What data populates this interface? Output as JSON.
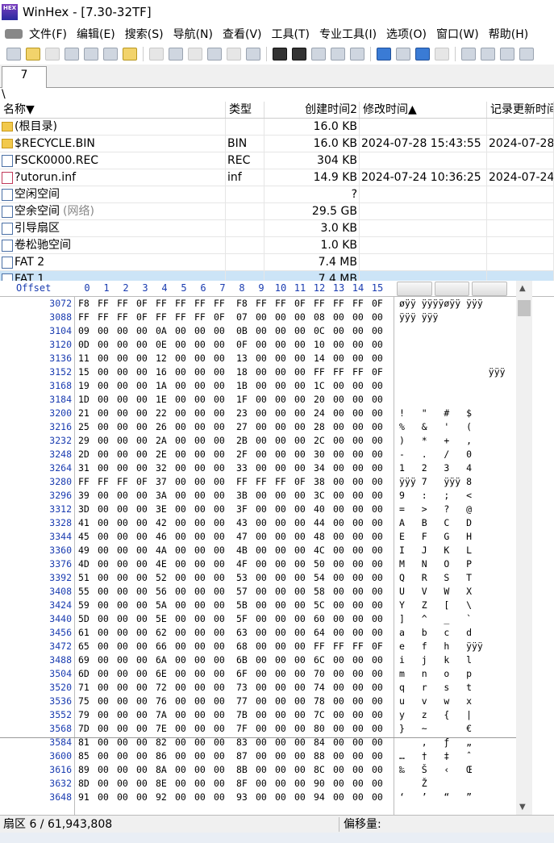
{
  "window": {
    "app_icon_text": "HEX",
    "title": "WinHex - [7.30-32TF]"
  },
  "menu": [
    "文件(F)",
    "编辑(E)",
    "搜索(S)",
    "导航(N)",
    "查看(V)",
    "工具(T)",
    "专业工具(I)",
    "选项(O)",
    "窗口(W)",
    "帮助(H)"
  ],
  "tab": {
    "label": "7"
  },
  "path": "\\",
  "file_list": {
    "headers": {
      "name": "名称▼",
      "type": "类型",
      "created": "创建时间2",
      "modified": "修改时间▲",
      "record_updated": "记录更新时间"
    },
    "rows": [
      {
        "icon": "folder-icon",
        "name": "(根目录)",
        "type": "",
        "size": "16.0 KB",
        "modified": "",
        "record": ""
      },
      {
        "icon": "folder-icon",
        "name": "$RECYCLE.BIN",
        "type": "BIN",
        "size": "16.0 KB",
        "modified": "2024-07-28  15:43:55",
        "record": "2024-07-28"
      },
      {
        "icon": "file-icon",
        "name": "FSCK0000.REC",
        "type": "REC",
        "size": "304 KB",
        "modified": "",
        "record": ""
      },
      {
        "icon": "deleted-file-icon",
        "name": "?utorun.inf",
        "type": "inf",
        "size": "14.9 KB",
        "modified": "2024-07-24  10:36:25",
        "record": "2024-07-24"
      },
      {
        "icon": "file-icon",
        "name": "空闲空间",
        "type": "",
        "size": "?",
        "modified": "",
        "record": ""
      },
      {
        "icon": "file-icon",
        "name": "空余空间",
        "name_suffix": "(网络)",
        "type": "",
        "size": "29.5 GB",
        "modified": "",
        "record": ""
      },
      {
        "icon": "file-icon",
        "name": "引导扇区",
        "type": "",
        "size": "3.0 KB",
        "modified": "",
        "record": ""
      },
      {
        "icon": "file-icon",
        "name": "卷松驰空间",
        "type": "",
        "size": "1.0 KB",
        "modified": "",
        "record": ""
      },
      {
        "icon": "file-icon",
        "name": "FAT 2",
        "type": "",
        "size": "7.4 MB",
        "modified": "",
        "record": ""
      },
      {
        "icon": "file-icon",
        "name": "FAT 1",
        "type": "",
        "size": "7.4 MB",
        "modified": "",
        "record": "",
        "selected": true
      }
    ]
  },
  "hex": {
    "offset_label": "Offset",
    "columns": [
      "0",
      "1",
      "2",
      "3",
      "4",
      "5",
      "6",
      "7",
      "8",
      "9",
      "10",
      "11",
      "12",
      "13",
      "14",
      "15"
    ],
    "rows": [
      {
        "offset": "3072",
        "bytes": [
          "F8",
          "FF",
          "FF",
          "0F",
          "FF",
          "FF",
          "FF",
          "FF",
          "F8",
          "FF",
          "FF",
          "0F",
          "FF",
          "FF",
          "FF",
          "0F"
        ],
        "ascii": "øÿÿ ÿÿÿÿøÿÿ ÿÿÿ"
      },
      {
        "offset": "3088",
        "bytes": [
          "FF",
          "FF",
          "FF",
          "0F",
          "FF",
          "FF",
          "FF",
          "0F",
          "07",
          "00",
          "00",
          "00",
          "08",
          "00",
          "00",
          "00"
        ],
        "ascii": "ÿÿÿ ÿÿÿ"
      },
      {
        "offset": "3104",
        "bytes": [
          "09",
          "00",
          "00",
          "00",
          "0A",
          "00",
          "00",
          "00",
          "0B",
          "00",
          "00",
          "00",
          "0C",
          "00",
          "00",
          "00"
        ],
        "ascii": ""
      },
      {
        "offset": "3120",
        "bytes": [
          "0D",
          "00",
          "00",
          "00",
          "0E",
          "00",
          "00",
          "00",
          "0F",
          "00",
          "00",
          "00",
          "10",
          "00",
          "00",
          "00"
        ],
        "ascii": ""
      },
      {
        "offset": "3136",
        "bytes": [
          "11",
          "00",
          "00",
          "00",
          "12",
          "00",
          "00",
          "00",
          "13",
          "00",
          "00",
          "00",
          "14",
          "00",
          "00",
          "00"
        ],
        "ascii": ""
      },
      {
        "offset": "3152",
        "bytes": [
          "15",
          "00",
          "00",
          "00",
          "16",
          "00",
          "00",
          "00",
          "18",
          "00",
          "00",
          "00",
          "FF",
          "FF",
          "FF",
          "0F"
        ],
        "ascii": "                ÿÿÿ"
      },
      {
        "offset": "3168",
        "bytes": [
          "19",
          "00",
          "00",
          "00",
          "1A",
          "00",
          "00",
          "00",
          "1B",
          "00",
          "00",
          "00",
          "1C",
          "00",
          "00",
          "00"
        ],
        "ascii": ""
      },
      {
        "offset": "3184",
        "bytes": [
          "1D",
          "00",
          "00",
          "00",
          "1E",
          "00",
          "00",
          "00",
          "1F",
          "00",
          "00",
          "00",
          "20",
          "00",
          "00",
          "00"
        ],
        "ascii": ""
      },
      {
        "offset": "3200",
        "bytes": [
          "21",
          "00",
          "00",
          "00",
          "22",
          "00",
          "00",
          "00",
          "23",
          "00",
          "00",
          "00",
          "24",
          "00",
          "00",
          "00"
        ],
        "ascii": "!   \"   #   $"
      },
      {
        "offset": "3216",
        "bytes": [
          "25",
          "00",
          "00",
          "00",
          "26",
          "00",
          "00",
          "00",
          "27",
          "00",
          "00",
          "00",
          "28",
          "00",
          "00",
          "00"
        ],
        "ascii": "%   &   '   ("
      },
      {
        "offset": "3232",
        "bytes": [
          "29",
          "00",
          "00",
          "00",
          "2A",
          "00",
          "00",
          "00",
          "2B",
          "00",
          "00",
          "00",
          "2C",
          "00",
          "00",
          "00"
        ],
        "ascii": ")   *   +   ,"
      },
      {
        "offset": "3248",
        "bytes": [
          "2D",
          "00",
          "00",
          "00",
          "2E",
          "00",
          "00",
          "00",
          "2F",
          "00",
          "00",
          "00",
          "30",
          "00",
          "00",
          "00"
        ],
        "ascii": "-   .   /   0"
      },
      {
        "offset": "3264",
        "bytes": [
          "31",
          "00",
          "00",
          "00",
          "32",
          "00",
          "00",
          "00",
          "33",
          "00",
          "00",
          "00",
          "34",
          "00",
          "00",
          "00"
        ],
        "ascii": "1   2   3   4"
      },
      {
        "offset": "3280",
        "bytes": [
          "FF",
          "FF",
          "FF",
          "0F",
          "37",
          "00",
          "00",
          "00",
          "FF",
          "FF",
          "FF",
          "0F",
          "38",
          "00",
          "00",
          "00"
        ],
        "ascii": "ÿÿÿ 7   ÿÿÿ 8"
      },
      {
        "offset": "3296",
        "bytes": [
          "39",
          "00",
          "00",
          "00",
          "3A",
          "00",
          "00",
          "00",
          "3B",
          "00",
          "00",
          "00",
          "3C",
          "00",
          "00",
          "00"
        ],
        "ascii": "9   :   ;   <"
      },
      {
        "offset": "3312",
        "bytes": [
          "3D",
          "00",
          "00",
          "00",
          "3E",
          "00",
          "00",
          "00",
          "3F",
          "00",
          "00",
          "00",
          "40",
          "00",
          "00",
          "00"
        ],
        "ascii": "=   >   ?   @"
      },
      {
        "offset": "3328",
        "bytes": [
          "41",
          "00",
          "00",
          "00",
          "42",
          "00",
          "00",
          "00",
          "43",
          "00",
          "00",
          "00",
          "44",
          "00",
          "00",
          "00"
        ],
        "ascii": "A   B   C   D"
      },
      {
        "offset": "3344",
        "bytes": [
          "45",
          "00",
          "00",
          "00",
          "46",
          "00",
          "00",
          "00",
          "47",
          "00",
          "00",
          "00",
          "48",
          "00",
          "00",
          "00"
        ],
        "ascii": "E   F   G   H"
      },
      {
        "offset": "3360",
        "bytes": [
          "49",
          "00",
          "00",
          "00",
          "4A",
          "00",
          "00",
          "00",
          "4B",
          "00",
          "00",
          "00",
          "4C",
          "00",
          "00",
          "00"
        ],
        "ascii": "I   J   K   L"
      },
      {
        "offset": "3376",
        "bytes": [
          "4D",
          "00",
          "00",
          "00",
          "4E",
          "00",
          "00",
          "00",
          "4F",
          "00",
          "00",
          "00",
          "50",
          "00",
          "00",
          "00"
        ],
        "ascii": "M   N   O   P"
      },
      {
        "offset": "3392",
        "bytes": [
          "51",
          "00",
          "00",
          "00",
          "52",
          "00",
          "00",
          "00",
          "53",
          "00",
          "00",
          "00",
          "54",
          "00",
          "00",
          "00"
        ],
        "ascii": "Q   R   S   T"
      },
      {
        "offset": "3408",
        "bytes": [
          "55",
          "00",
          "00",
          "00",
          "56",
          "00",
          "00",
          "00",
          "57",
          "00",
          "00",
          "00",
          "58",
          "00",
          "00",
          "00"
        ],
        "ascii": "U   V   W   X"
      },
      {
        "offset": "3424",
        "bytes": [
          "59",
          "00",
          "00",
          "00",
          "5A",
          "00",
          "00",
          "00",
          "5B",
          "00",
          "00",
          "00",
          "5C",
          "00",
          "00",
          "00"
        ],
        "ascii": "Y   Z   [   \\"
      },
      {
        "offset": "3440",
        "bytes": [
          "5D",
          "00",
          "00",
          "00",
          "5E",
          "00",
          "00",
          "00",
          "5F",
          "00",
          "00",
          "00",
          "60",
          "00",
          "00",
          "00"
        ],
        "ascii": "]   ^   _   `"
      },
      {
        "offset": "3456",
        "bytes": [
          "61",
          "00",
          "00",
          "00",
          "62",
          "00",
          "00",
          "00",
          "63",
          "00",
          "00",
          "00",
          "64",
          "00",
          "00",
          "00"
        ],
        "ascii": "a   b   c   d"
      },
      {
        "offset": "3472",
        "bytes": [
          "65",
          "00",
          "00",
          "00",
          "66",
          "00",
          "00",
          "00",
          "68",
          "00",
          "00",
          "00",
          "FF",
          "FF",
          "FF",
          "0F"
        ],
        "ascii": "e   f   h   ÿÿÿ"
      },
      {
        "offset": "3488",
        "bytes": [
          "69",
          "00",
          "00",
          "00",
          "6A",
          "00",
          "00",
          "00",
          "6B",
          "00",
          "00",
          "00",
          "6C",
          "00",
          "00",
          "00"
        ],
        "ascii": "i   j   k   l"
      },
      {
        "offset": "3504",
        "bytes": [
          "6D",
          "00",
          "00",
          "00",
          "6E",
          "00",
          "00",
          "00",
          "6F",
          "00",
          "00",
          "00",
          "70",
          "00",
          "00",
          "00"
        ],
        "ascii": "m   n   o   p"
      },
      {
        "offset": "3520",
        "bytes": [
          "71",
          "00",
          "00",
          "00",
          "72",
          "00",
          "00",
          "00",
          "73",
          "00",
          "00",
          "00",
          "74",
          "00",
          "00",
          "00"
        ],
        "ascii": "q   r   s   t"
      },
      {
        "offset": "3536",
        "bytes": [
          "75",
          "00",
          "00",
          "00",
          "76",
          "00",
          "00",
          "00",
          "77",
          "00",
          "00",
          "00",
          "78",
          "00",
          "00",
          "00"
        ],
        "ascii": "u   v   w   x"
      },
      {
        "offset": "3552",
        "bytes": [
          "79",
          "00",
          "00",
          "00",
          "7A",
          "00",
          "00",
          "00",
          "7B",
          "00",
          "00",
          "00",
          "7C",
          "00",
          "00",
          "00"
        ],
        "ascii": "y   z   {   |"
      },
      {
        "offset": "3568",
        "bytes": [
          "7D",
          "00",
          "00",
          "00",
          "7E",
          "00",
          "00",
          "00",
          "7F",
          "00",
          "00",
          "00",
          "80",
          "00",
          "00",
          "00"
        ],
        "ascii": "}   ~       €"
      },
      {
        "offset": "3584",
        "bytes": [
          "81",
          "00",
          "00",
          "00",
          "82",
          "00",
          "00",
          "00",
          "83",
          "00",
          "00",
          "00",
          "84",
          "00",
          "00",
          "00"
        ],
        "ascii": "    ‚   ƒ   „"
      },
      {
        "offset": "3600",
        "bytes": [
          "85",
          "00",
          "00",
          "00",
          "86",
          "00",
          "00",
          "00",
          "87",
          "00",
          "00",
          "00",
          "88",
          "00",
          "00",
          "00"
        ],
        "ascii": "…   †   ‡   ˆ"
      },
      {
        "offset": "3616",
        "bytes": [
          "89",
          "00",
          "00",
          "00",
          "8A",
          "00",
          "00",
          "00",
          "8B",
          "00",
          "00",
          "00",
          "8C",
          "00",
          "00",
          "00"
        ],
        "ascii": "‰   Š   ‹   Œ"
      },
      {
        "offset": "3632",
        "bytes": [
          "8D",
          "00",
          "00",
          "00",
          "8E",
          "00",
          "00",
          "00",
          "8F",
          "00",
          "00",
          "00",
          "90",
          "00",
          "00",
          "00"
        ],
        "ascii": "    Ž"
      },
      {
        "offset": "3648",
        "bytes": [
          "91",
          "00",
          "00",
          "00",
          "92",
          "00",
          "00",
          "00",
          "93",
          "00",
          "00",
          "00",
          "94",
          "00",
          "00",
          "00"
        ],
        "ascii": "‘   ’   “   ”"
      }
    ]
  },
  "status": {
    "sector": "扇区 6 / 61,943,808",
    "offset_label": "偏移量:"
  }
}
